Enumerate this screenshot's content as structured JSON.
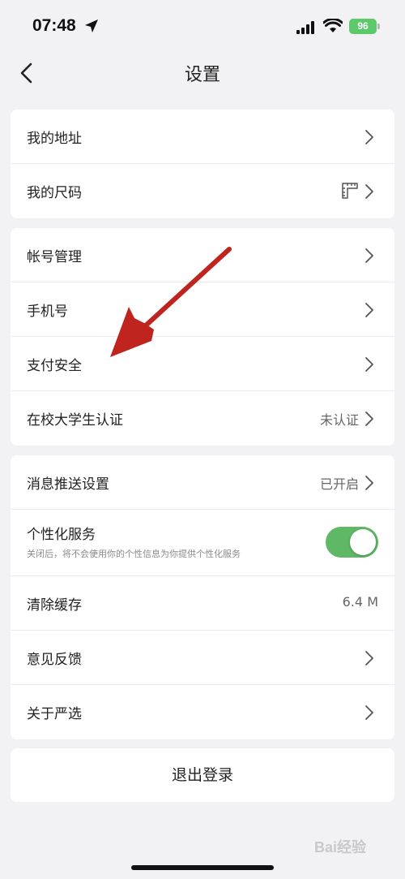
{
  "status_bar": {
    "time": "07:48",
    "battery": "96"
  },
  "nav": {
    "title": "设置"
  },
  "group1": [
    {
      "label": "我的地址"
    },
    {
      "label": "我的尺码"
    }
  ],
  "group2": [
    {
      "label": "帐号管理"
    },
    {
      "label": "手机号"
    },
    {
      "label": "支付安全"
    },
    {
      "label": "在校大学生认证",
      "value": "未认证"
    }
  ],
  "group3": {
    "push": {
      "label": "消息推送设置",
      "value": "已开启"
    },
    "personal": {
      "label": "个性化服务",
      "sub": "关闭后，将不会使用你的个性信息为你提供个性化服务",
      "enabled": true
    },
    "cache": {
      "label": "清除缓存",
      "value": "6.4 M"
    },
    "feedback": {
      "label": "意见反馈"
    },
    "about": {
      "label": "关于严选"
    }
  },
  "logout": {
    "label": "退出登录"
  },
  "watermark": "Bai经验",
  "colors": {
    "toggle_on": "#5fb866",
    "annotation_arrow": "#c0241f"
  }
}
